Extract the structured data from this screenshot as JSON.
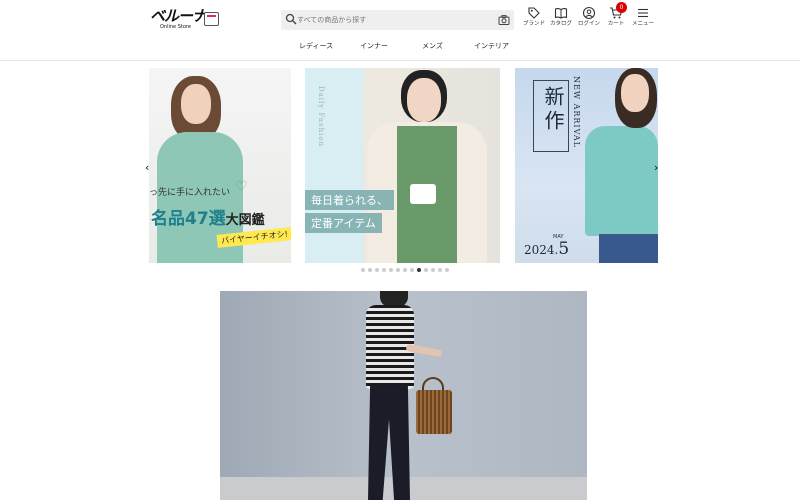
{
  "brand": {
    "logo_text": "ベルーナ",
    "logo_sub": "Online Store"
  },
  "search": {
    "placeholder": "すべての商品から探す"
  },
  "header_utils": {
    "brand_label": "ブランド",
    "catalog_label": "カタログ",
    "login_label": "ログイン",
    "cart_label": "カート",
    "cart_count": "0",
    "menu_label": "メニュー"
  },
  "nav": {
    "items": [
      {
        "label": "レディース"
      },
      {
        "label": "インナー"
      },
      {
        "label": "メンズ"
      },
      {
        "label": "インテリア"
      }
    ]
  },
  "carousel": {
    "slide1": {
      "small_text": "っ先に手に入れたい",
      "heart": "♡",
      "big_text_1": "名品",
      "big_text_num": "47",
      "big_text_2": "選",
      "big_text_3": "大図鑑",
      "tag": "バイヤーイチオシ!"
    },
    "slide2": {
      "vertical_text": "Daily Fashion",
      "line1": "毎日着られる、",
      "line2": "定番アイテム"
    },
    "slide3": {
      "kanji": "新作",
      "new_arrival": "NEW ARRIVAL",
      "month_label": "MAY",
      "year": "2024.",
      "month": "5"
    },
    "prev_arrow": "‹",
    "next_arrow": "›",
    "dot_count": 13,
    "active_dot": 8
  },
  "colors": {
    "accent_teal": "#1f7f8a",
    "badge_red": "#dd0000",
    "tag_yellow": "#ffe94f"
  },
  "icons": {
    "search": "search-icon",
    "camera": "camera-icon",
    "brand": "tag-icon",
    "catalog": "book-icon",
    "login": "user-icon",
    "cart": "cart-icon",
    "menu": "hamburger-icon"
  }
}
